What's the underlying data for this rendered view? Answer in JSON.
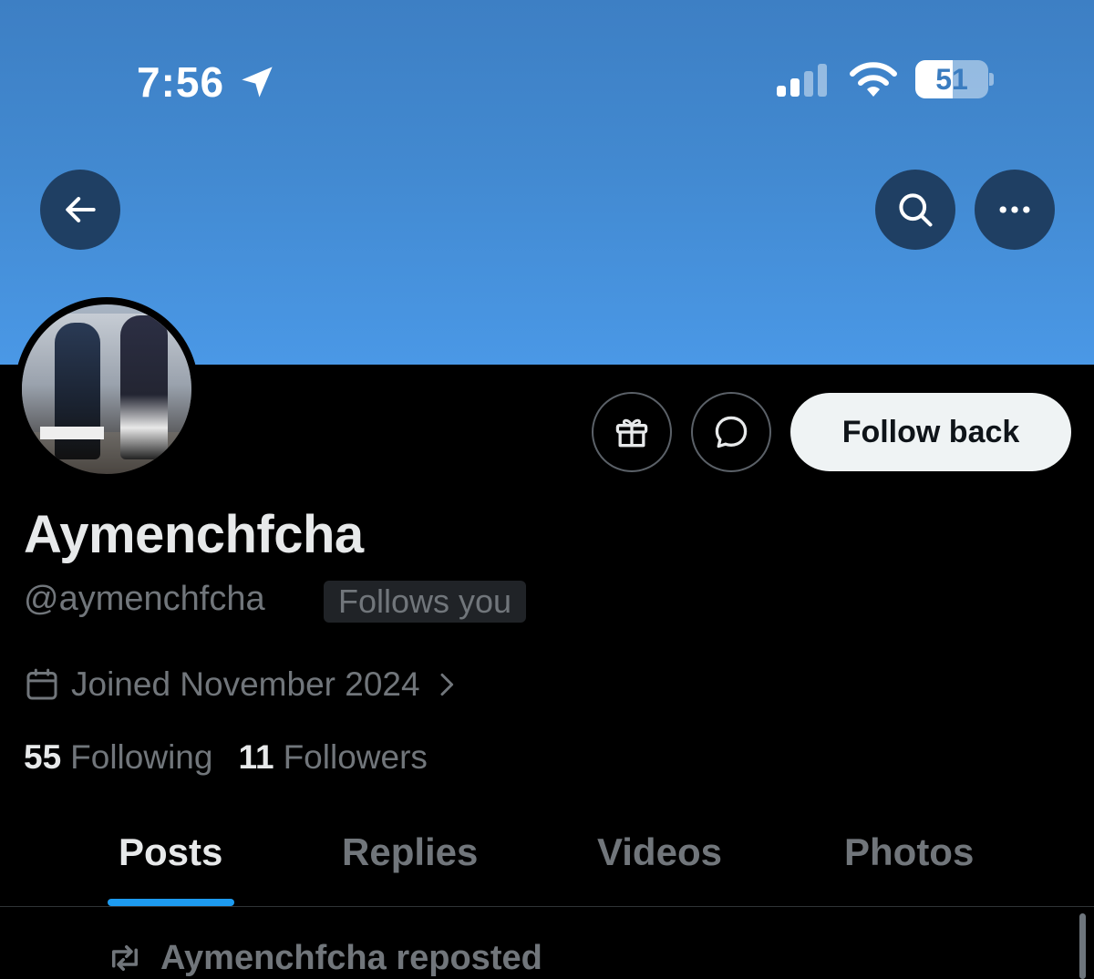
{
  "status_bar": {
    "time": "7:56",
    "battery": "51",
    "battery_level": 0.51
  },
  "nav": {
    "back_icon": "back-arrow-icon",
    "search_icon": "search-icon",
    "more_icon": "more-icon"
  },
  "profile": {
    "display_name": "Aymenchfcha",
    "handle": "@aymenchfcha",
    "follows_you_badge": "Follows you",
    "joined": "Joined November 2024",
    "following_count": "55",
    "following_label": "Following",
    "followers_count": "11",
    "followers_label": "Followers"
  },
  "actions": {
    "gift_icon": "gift-icon",
    "message_icon": "message-icon",
    "follow_back_label": "Follow back"
  },
  "tabs": [
    {
      "label": "Posts",
      "active": true
    },
    {
      "label": "Replies",
      "active": false
    },
    {
      "label": "Videos",
      "active": false
    },
    {
      "label": "Photos",
      "active": false
    }
  ],
  "feed": {
    "repost_text": "Aymenchfcha reposted"
  },
  "colors": {
    "banner": "#4289d0",
    "accent": "#1d9bf0",
    "background": "#000000",
    "muted_text": "#71767b"
  }
}
